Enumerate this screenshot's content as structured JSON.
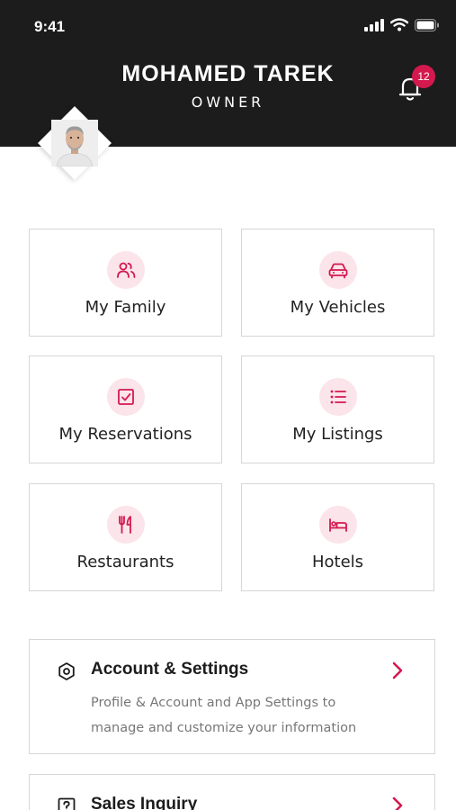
{
  "status_bar": {
    "time": "9:41"
  },
  "profile": {
    "name": "MOHAMED TAREK",
    "role": "OWNER"
  },
  "notifications": {
    "count": "12"
  },
  "tiles": [
    {
      "label": "My Family",
      "icon": "family-icon"
    },
    {
      "label": "My Vehicles",
      "icon": "car-icon"
    },
    {
      "label": "My Reservations",
      "icon": "calendar-check-icon"
    },
    {
      "label": "My Listings",
      "icon": "list-icon"
    },
    {
      "label": "Restaurants",
      "icon": "fork-knife-icon"
    },
    {
      "label": "Hotels",
      "icon": "bed-icon"
    }
  ],
  "cards": [
    {
      "title": "Account & Settings",
      "description": "Profile & Account and App Settings to manage and customize your information",
      "icon": "settings-hexagon-icon"
    },
    {
      "title": "Sales Inquiry",
      "icon": "question-icon"
    }
  ],
  "colors": {
    "header_bg": "#1c1c1c",
    "accent": "#d4194f",
    "icon_bg": "#fbe4ea",
    "border": "#d6d6d6"
  }
}
